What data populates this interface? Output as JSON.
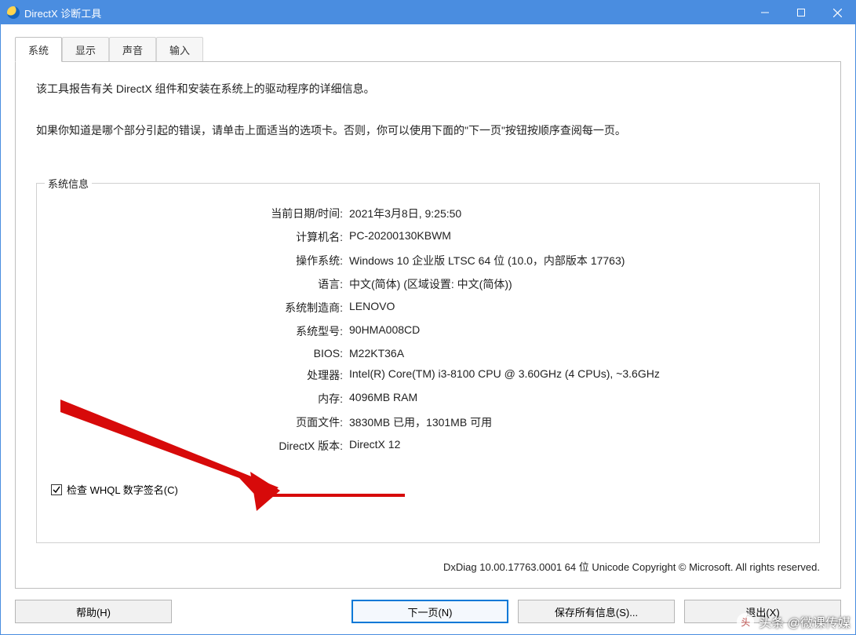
{
  "window": {
    "title": "DirectX 诊断工具"
  },
  "tabs": [
    {
      "label": "系统",
      "active": true
    },
    {
      "label": "显示",
      "active": false
    },
    {
      "label": "声音",
      "active": false
    },
    {
      "label": "输入",
      "active": false
    }
  ],
  "intro": {
    "line1": "该工具报告有关 DirectX 组件和安装在系统上的驱动程序的详细信息。",
    "line2": "如果你知道是哪个部分引起的错误，请单击上面适当的选项卡。否则，你可以使用下面的\"下一页\"按钮按顺序查阅每一页。"
  },
  "group": {
    "title": "系统信息",
    "rows": [
      {
        "label": "当前日期/时间:",
        "value": "2021年3月8日, 9:25:50"
      },
      {
        "label": "计算机名:",
        "value": "PC-20200130KBWM"
      },
      {
        "label": "操作系统:",
        "value": "Windows 10 企业版 LTSC 64 位 (10.0，内部版本 17763)"
      },
      {
        "label": "语言:",
        "value": "中文(简体) (区域设置: 中文(简体))"
      },
      {
        "label": "系统制造商:",
        "value": "LENOVO"
      },
      {
        "label": "系统型号:",
        "value": "90HMA008CD"
      },
      {
        "label": "BIOS:",
        "value": "M22KT36A"
      },
      {
        "label": "处理器:",
        "value": "Intel(R) Core(TM) i3-8100 CPU @ 3.60GHz (4 CPUs), ~3.6GHz"
      },
      {
        "label": "内存:",
        "value": "4096MB RAM"
      },
      {
        "label": "页面文件:",
        "value": "3830MB 已用，1301MB 可用"
      },
      {
        "label": "DirectX 版本:",
        "value": "DirectX 12"
      }
    ],
    "checkbox": {
      "checked": true,
      "label": "检查 WHQL 数字签名(C)"
    }
  },
  "footer": "DxDiag 10.00.17763.0001 64 位 Unicode  Copyright © Microsoft. All rights reserved.",
  "buttons": {
    "help": "帮助(H)",
    "next": "下一页(N)",
    "save": "保存所有信息(S)...",
    "exit": "退出(X)"
  },
  "watermark": {
    "text": "头条 @微课传媒"
  },
  "colors": {
    "titlebar": "#4a8de0",
    "annotation": "#d70a0a",
    "default_button_border": "#0078d7"
  }
}
